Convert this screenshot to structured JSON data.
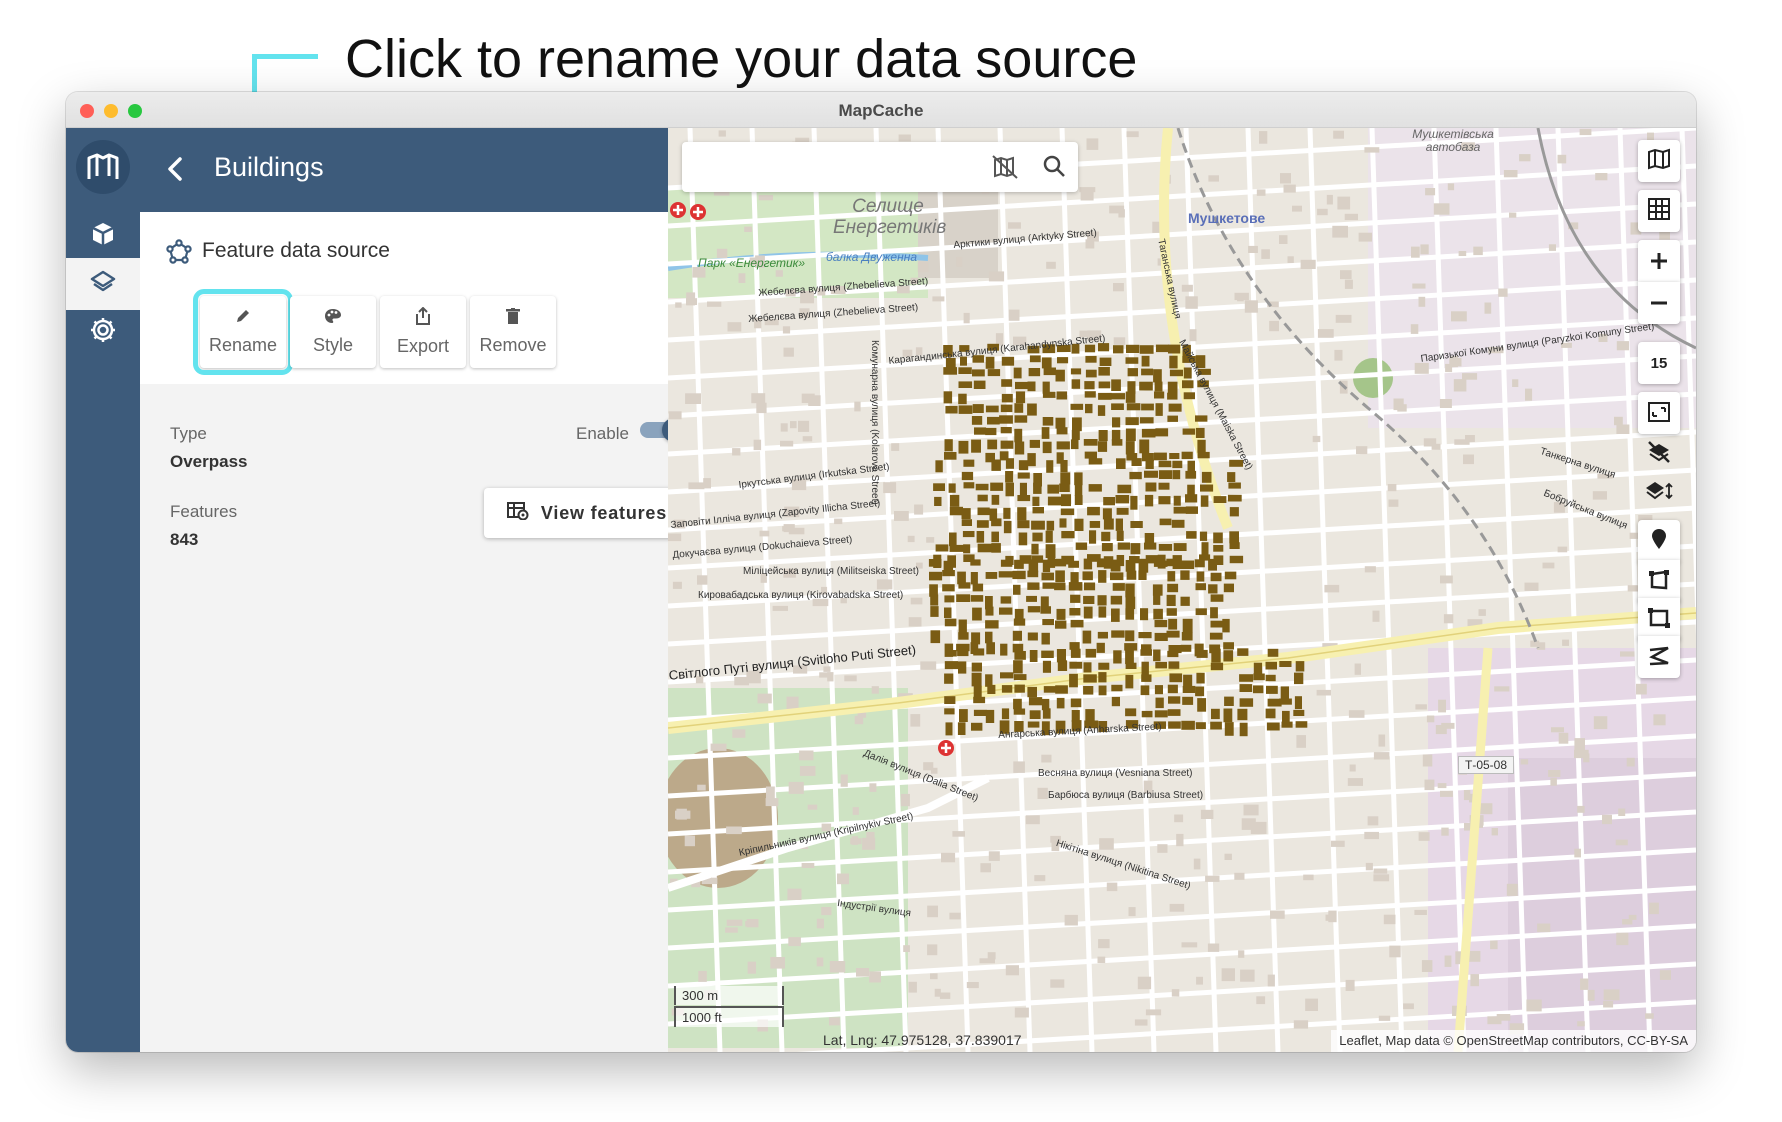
{
  "annotation": {
    "text": "Click to rename your data source",
    "highlight_color": "#63e3ee"
  },
  "window": {
    "title": "MapCache",
    "traffic_lights": [
      "#ff5f57",
      "#febc2e",
      "#28c840"
    ]
  },
  "rail": {
    "items": [
      {
        "icon": "mapcache-logo-icon"
      },
      {
        "icon": "cube-icon"
      },
      {
        "icon": "layers-icon",
        "active": true
      },
      {
        "icon": "gear-icon"
      }
    ]
  },
  "panel": {
    "back_icon": "chevron-left-icon",
    "title": "Buildings",
    "source_label": "Feature data source",
    "actions": {
      "rename": "Rename",
      "style": "Style",
      "export": "Export",
      "remove": "Remove"
    },
    "type_label": "Type",
    "type_value": "Overpass",
    "enable_label": "Enable",
    "enabled": true,
    "features_label": "Features",
    "features_count": "843",
    "view_features": "View features"
  },
  "map": {
    "search_placeholder": "",
    "zoom_level": "15",
    "labels": {
      "settlement": "Селище Енергетиків",
      "district": "Мушкетове",
      "park": "Парк «Енергетик»",
      "ravine": "балка Двуженна",
      "depot": "Мушкетівська автобаза",
      "power_line": "Т-05-08",
      "main_street": "Світлого Путі вулиця (Svitloho Puti Street)",
      "street_arktyky": "Арктики вулиця (Arktyky Street)",
      "street_zhebelieva_1": "Жебелєва вулиця (Zhebelieva Street)",
      "street_zhebelieva_2": "Жебелєва вулиця (Zhebelieva Street)",
      "street_karahandynska": "Карагандинська вулиця (Karahandynska Street)",
      "street_irkutska": "Іркутська вулиця (Irkutska Street)",
      "street_zapovity": "Заповіти Ілліча вулиця (Zapovity Illicha Street)",
      "street_dokuchaieva": "Докучаєва вулиця (Dokuchaieva Street)",
      "street_militseiska": "Міліцейська вулиця (Militseiska Street)",
      "street_kirovabadska": "Кировабадська вулиця (Kirovabadska Street)",
      "street_anharska": "Ангарська вулиця (Anharska Street)",
      "street_dalia": "Далія вулиця (Dalia Street)",
      "street_vesniana": "Весняна вулиця (Vesniana Street)",
      "street_barbiusa": "Барбюса вулиця (Barbiusa Street)",
      "street_kripylnykiv": "Кріпильників вулиця (Kripilnykiv Street)",
      "street_nikitina": "Нікітіна вулиця (Nikitina Street)",
      "street_industrii": "Індустрії вулиця",
      "street_parizkoi": "Паризької Комуни вулиця (Paryzkoi Komuny Street)",
      "street_tankerna": "Танкерна вулиця",
      "street_bobruiska": "Бобруйська вулиця",
      "street_maiska": "Майська вулиця (Maiska Street)",
      "street_tahanska": "Таганська вулиця",
      "street_komunar": "Комунарна вулиця (Kolarova Street)"
    },
    "scale_metric": "300 m",
    "scale_imperial": "1000 ft",
    "latlng": "Lat, Lng: 47.975128, 37.839017",
    "attribution": "Leaflet, Map data © OpenStreetMap contributors, CC-BY-SA",
    "building_color": "#7a5c14",
    "controls": [
      "map-icon",
      "grid-icon",
      "zoom-in-icon",
      "zoom-out-icon",
      "zoom-level",
      "fit-bounds-icon",
      "layers-off-icon",
      "layers-toggle-icon",
      "marker-icon",
      "polygon-icon",
      "rectangle-icon",
      "polyline-icon"
    ]
  }
}
